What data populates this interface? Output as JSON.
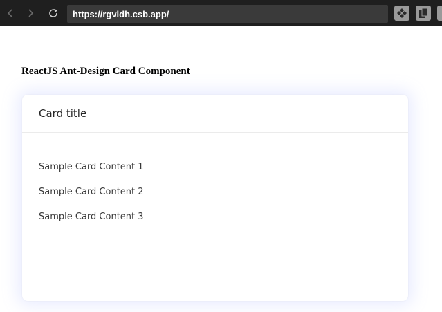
{
  "browser": {
    "url": "https://rgvldh.csb.app/",
    "icons": [
      "back-arrow-icon",
      "forward-arrow-icon",
      "reload-icon",
      "extension-icon",
      "copy-icon"
    ]
  },
  "page": {
    "heading": "ReactJS Ant-Design Card Component"
  },
  "card": {
    "title": "Card title",
    "content": [
      "Sample Card Content 1",
      "Sample Card Content 2",
      "Sample Card Content 3"
    ]
  },
  "colors": {
    "browser_bar": "#1f1f1f",
    "address_bar": "#3a3a3a",
    "card_shadow": "#96a5ff"
  }
}
